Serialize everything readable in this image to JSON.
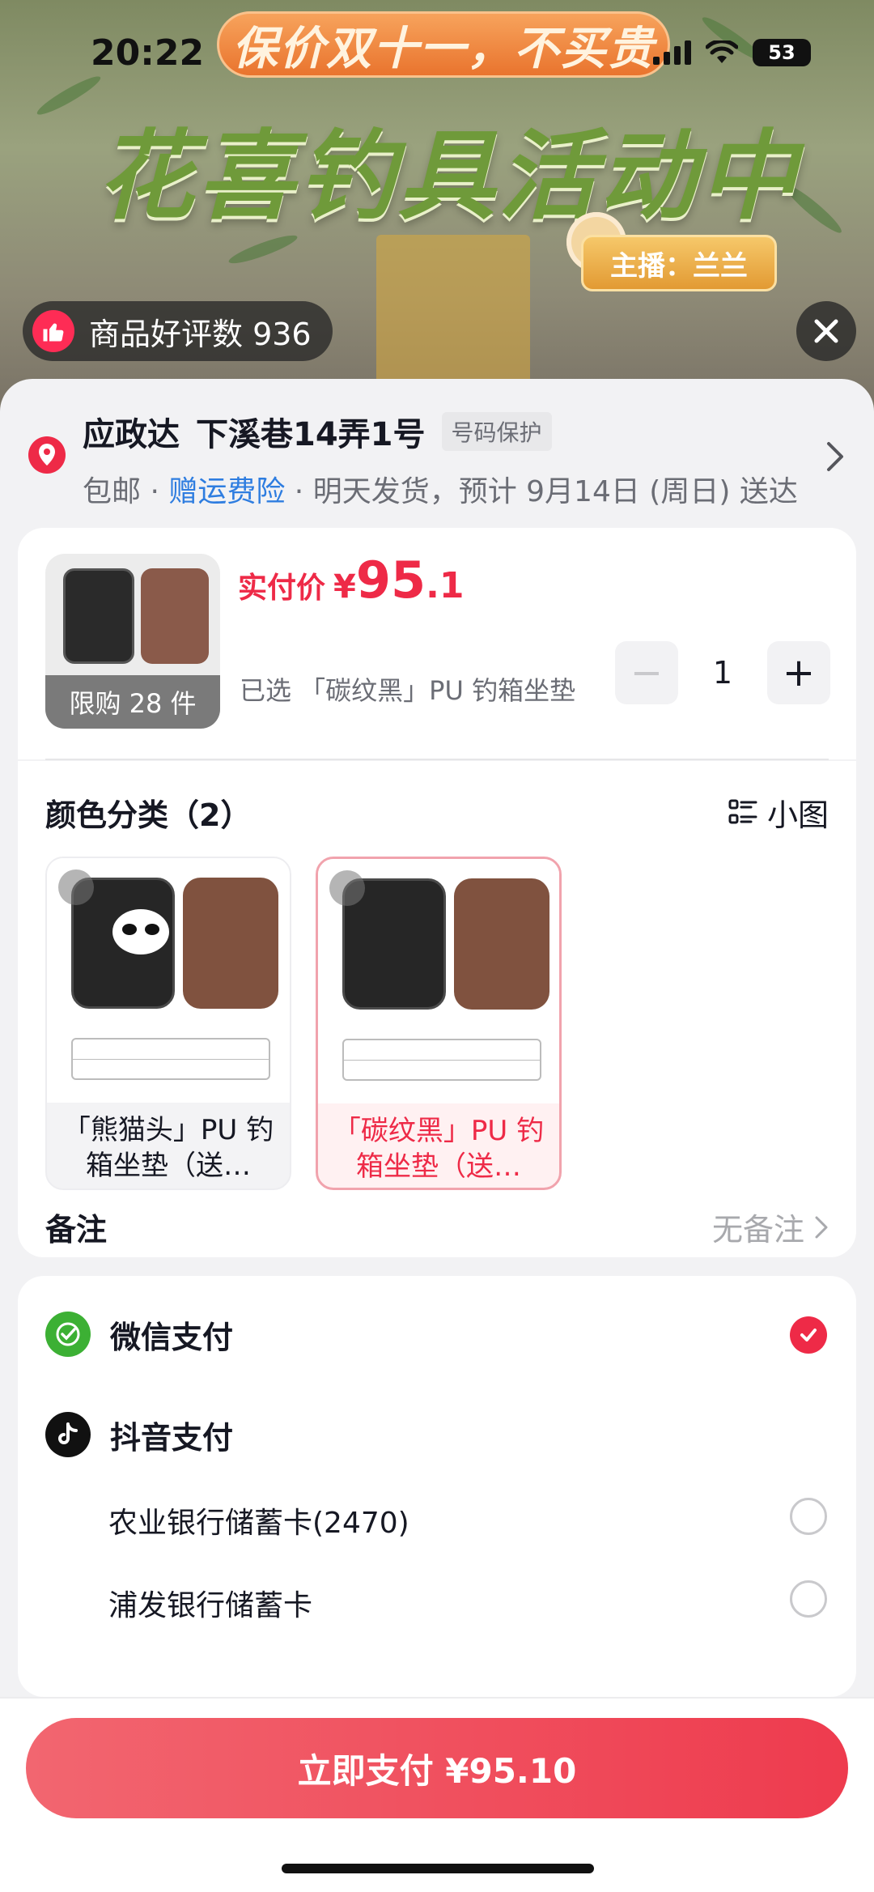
{
  "status_bar": {
    "time": "20:22",
    "battery": "53"
  },
  "live": {
    "banner": "保价双十一，不买贵",
    "title": "花喜钓具活动中",
    "host": "主播：兰兰",
    "review_badge": "商品好评数 936"
  },
  "address": {
    "name": "应政达",
    "detail": "下溪巷14弄1号",
    "protect": "号码保护",
    "shipping_free": "包邮 · ",
    "insurance": "赠运费险",
    "delivery": " · 明天发货，预计 9月14日 (周日) 送达"
  },
  "product": {
    "price_label": "实付价",
    "price_symbol": "¥",
    "price_int": "95",
    "price_dec": ".1",
    "limit": "限购 28 件",
    "selected": "已选 「碳纹黑」PU 钓箱坐垫（送…",
    "qty_minus": "−",
    "qty": "1",
    "qty_plus": "+"
  },
  "color_section": {
    "title": "颜色分类（2）",
    "view_toggle": "小图",
    "variants": [
      {
        "label": "「熊猫头」PU 钓箱坐垫（送…",
        "selected": false
      },
      {
        "label": "「碳纹黑」PU 钓箱坐垫（送…",
        "selected": true
      }
    ]
  },
  "remark": {
    "label": "备注",
    "value": "无备注"
  },
  "payment": {
    "wechat": "微信支付",
    "douyin": "抖音支付",
    "banks": [
      "农业银行储蓄卡(2470)",
      "浦发银行储蓄卡"
    ]
  },
  "pay_button": "立即支付 ¥95.10",
  "colors": {
    "accent": "#EE2A47",
    "link": "#2E7DE0",
    "wechat": "#3CB034"
  }
}
